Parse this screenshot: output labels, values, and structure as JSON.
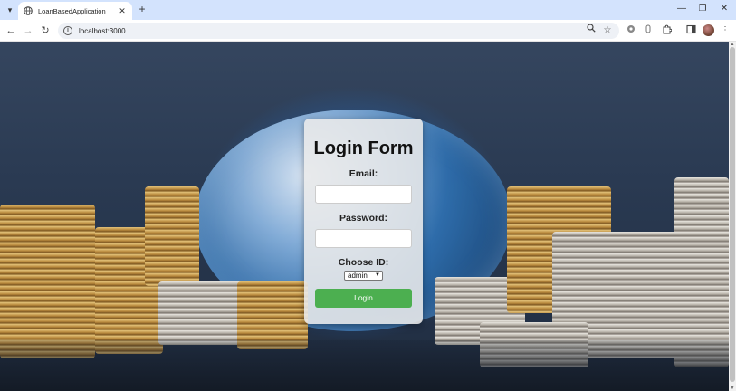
{
  "browser": {
    "tab": {
      "title": "LoanBasedApplication",
      "close_icon": "✕"
    },
    "new_tab_icon": "+",
    "window_controls": {
      "minimize": "—",
      "restore": "❐",
      "close": "✕"
    },
    "toolbar": {
      "back_icon": "←",
      "forward_icon": "→",
      "reload_icon": "↻",
      "url": "localhost:3000",
      "zoom_icon": "🔍",
      "star_icon": "☆"
    }
  },
  "login_form": {
    "title": "Login Form",
    "email_label": "Email:",
    "email_value": "",
    "password_label": "Password:",
    "password_value": "",
    "choose_id_label": "Choose ID:",
    "choose_id_selected": "admin",
    "login_button": "Login",
    "button_color": "#4caf50"
  }
}
